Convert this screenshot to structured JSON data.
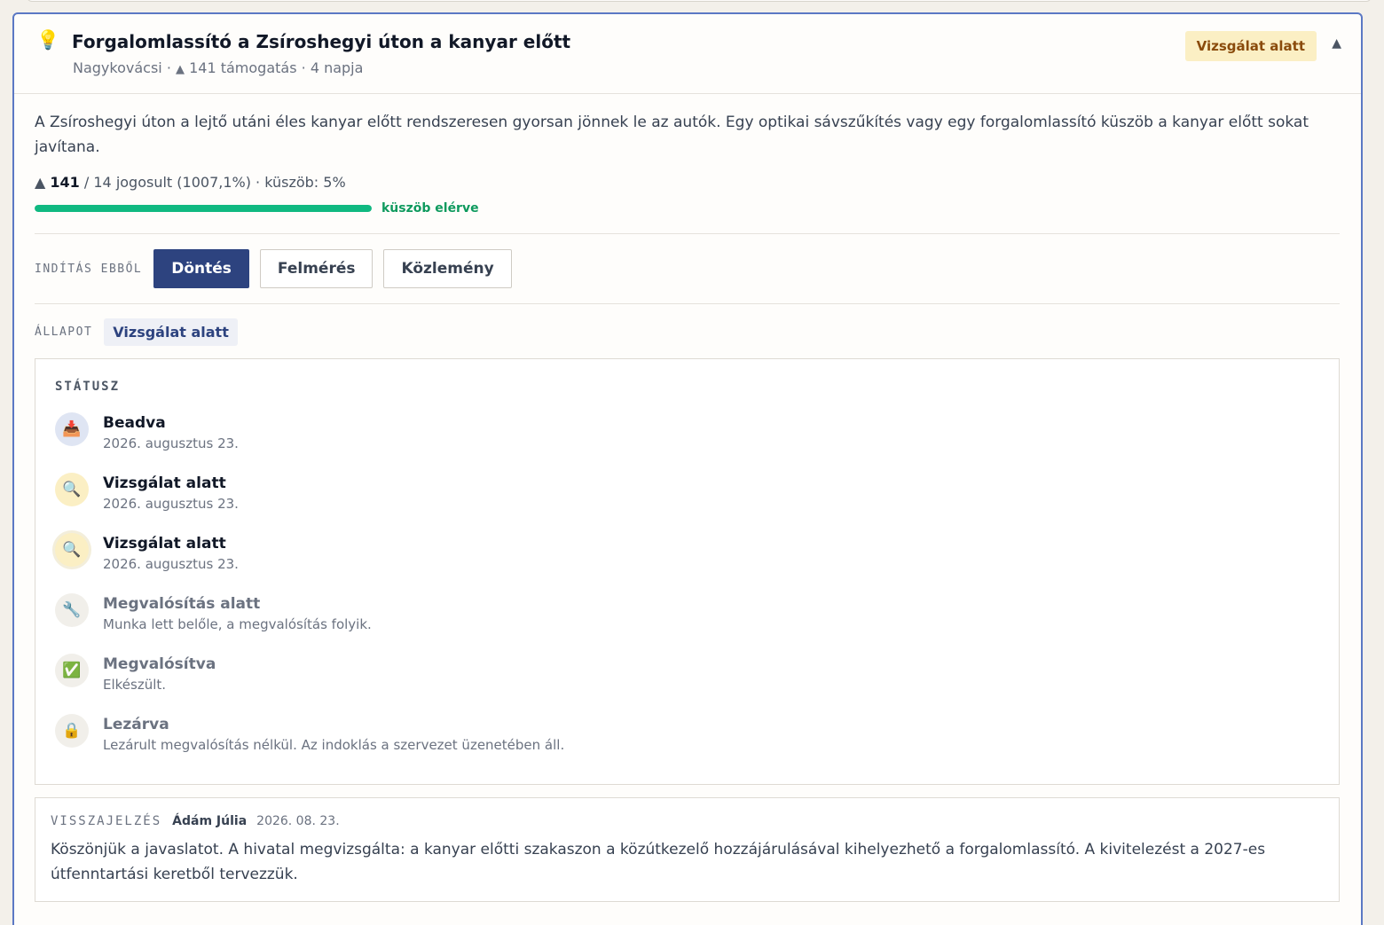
{
  "card": {
    "title": "Forgalomlassító a Zsíroshegyi úton a kanyar előtt",
    "meta_location": "Nagykovácsi",
    "meta_support_arrow": "▲",
    "meta_support": "141 támogatás",
    "meta_age": "4 napja",
    "badge": "Vizsgálat alatt",
    "collapse_icon": "▲",
    "icon": "lightbulb-icon"
  },
  "description": "A Zsíroshegyi úton a lejtő utáni éles kanyar előtt rendszeresen gyorsan jönnek le az autók. Egy optikai sávszűkítés vagy egy forgalomlassító küszöb a kanyar előtt sokat javítana.",
  "votes": {
    "arrow": "▲",
    "count": "141",
    "rest": " / 14 jogosult (1007,1%)",
    "threshold": " · küszöb: 5%",
    "progress_fraction": 1.0,
    "progress_label": "küszöb elérve",
    "progress_color": "#10b981"
  },
  "launch": {
    "label": "INDÍTÁS EBBŐL",
    "buttons": [
      "Döntés",
      "Felmérés",
      "Közlemény"
    ]
  },
  "state": {
    "label": "ÁLLAPOT",
    "value": "Vizsgálat alatt"
  },
  "status": {
    "heading": "STÁTUSZ",
    "steps": [
      {
        "icon": "inbox-tray-icon",
        "glyph": "📥",
        "title": "Beadva",
        "sub": "2026. augusztus 23."
      },
      {
        "icon": "magnifier-icon",
        "glyph": "🔍",
        "title": "Vizsgálat alatt",
        "sub": "2026. augusztus 23."
      },
      {
        "icon": "magnifier-icon",
        "glyph": "🔍",
        "title": "Vizsgálat alatt",
        "sub": "2026. augusztus 23."
      },
      {
        "icon": "wrench-icon",
        "glyph": "🔧",
        "title": "Megvalósítás alatt",
        "sub": "Munka lett belőle, a megvalósítás folyik."
      },
      {
        "icon": "check-mark-icon",
        "glyph": "✅",
        "title": "Megvalósítva",
        "sub": "Elkészült."
      },
      {
        "icon": "lock-icon",
        "glyph": "🔒",
        "title": "Lezárva",
        "sub": "Lezárult megvalósítás nélkül. Az indoklás a szervezet üzenetében áll."
      }
    ]
  },
  "feedback": {
    "label": "VISSZAJELZÉS",
    "author": "Ádám Júlia",
    "date": "2026. 08. 23.",
    "text": "Köszönjük a javaslatot. A hivatal megvizsgálta: a kanyar előtti szakaszon a közútkezelő hozzájárulásával kihelyezhető a forgalomlassító. A kivitelezést a 2027-es útfenntartási keretből tervezzük."
  },
  "colors": {
    "accent_border": "#5b78c4",
    "primary_button": "#2d437f",
    "badge_bg": "#fbefc4",
    "badge_text": "#8a4b0c"
  }
}
